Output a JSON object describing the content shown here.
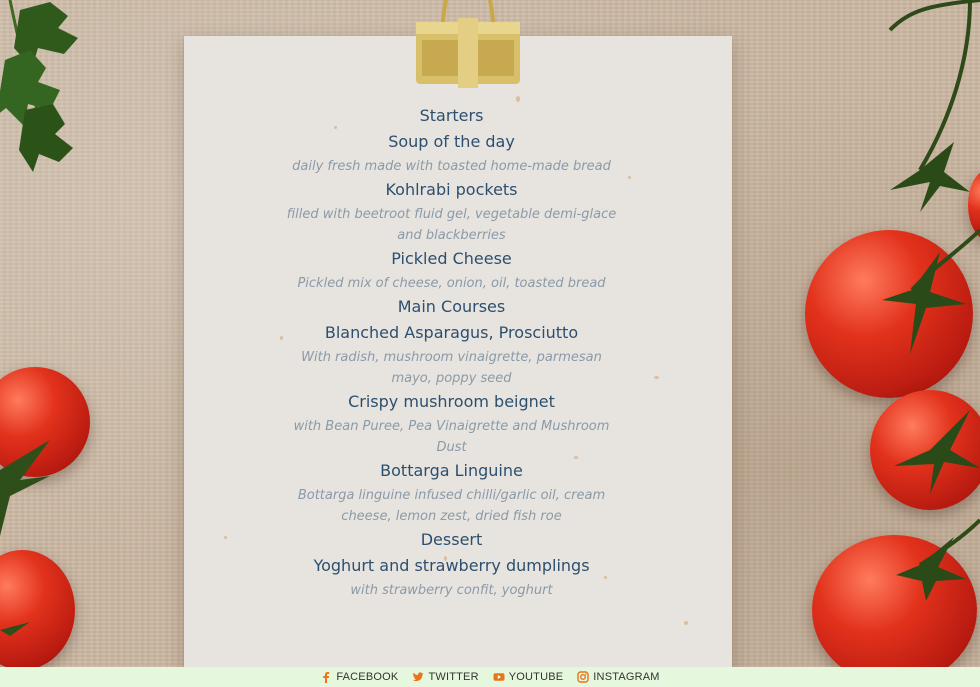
{
  "menu": {
    "sections": [
      {
        "title": "Starters",
        "items": [
          {
            "name": "Soup of the day",
            "description": "daily fresh made with toasted home-made bread"
          },
          {
            "name": "Kohlrabi pockets",
            "description": "filled with beetroot fluid gel, vegetable demi-glace and blackberries"
          },
          {
            "name": "Pickled Cheese",
            "description": "Pickled mix of cheese, onion, oil, toasted bread"
          }
        ]
      },
      {
        "title": "Main Courses",
        "items": [
          {
            "name": "Blanched Asparagus, Prosciutto",
            "description": "With radish, mushroom vinaigrette, parmesan mayo, poppy seed"
          },
          {
            "name": "Crispy mushroom beignet",
            "description": "with Bean Puree, Pea Vinaigrette and Mushroom Dust"
          },
          {
            "name": "Bottarga Linguine",
            "description": "Bottarga linguine infused chilli/garlic oil, cream cheese, lemon zest, dried fish roe"
          }
        ]
      },
      {
        "title": "Dessert",
        "items": [
          {
            "name": "Yoghurt and strawberry dumplings",
            "description": "with strawberry confit, yoghurt"
          }
        ]
      }
    ]
  },
  "footer": {
    "links": [
      {
        "label": "FACEBOOK",
        "icon": "facebook-icon"
      },
      {
        "label": "TWITTER",
        "icon": "twitter-icon"
      },
      {
        "label": "YOUTUBE",
        "icon": "youtube-icon"
      },
      {
        "label": "INSTAGRAM",
        "icon": "instagram-icon"
      }
    ],
    "icon_color": "#e8751a"
  }
}
